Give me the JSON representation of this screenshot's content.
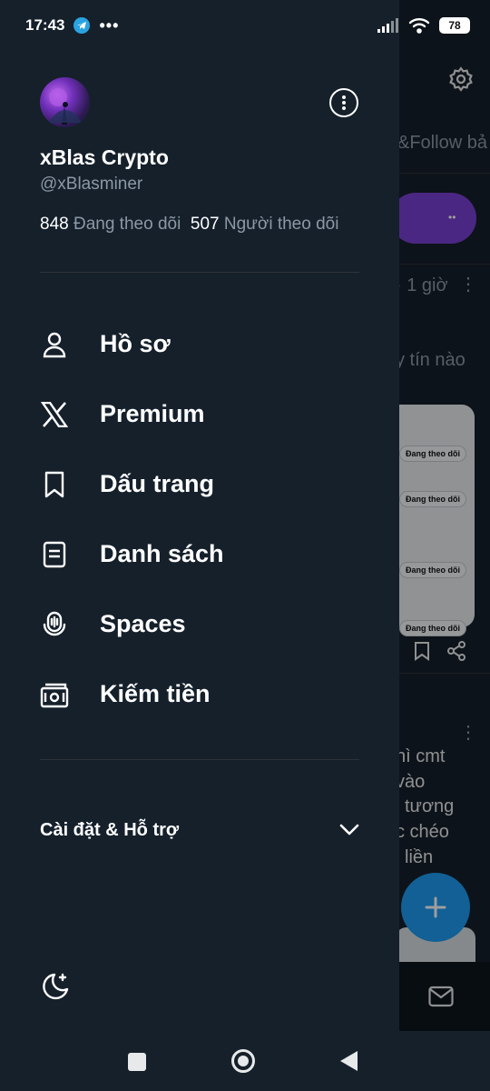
{
  "status_bar": {
    "time": "17:43",
    "more": "•••",
    "battery": "78"
  },
  "background_feed": {
    "tab_partial": "y&Follow bả",
    "time_partial": "· 1 giờ",
    "text_partial": "y tín nào",
    "pills": [
      "Đang theo dõi",
      "Đang theo dõi",
      "Đang theo dõi",
      "Đang theo dõi"
    ],
    "lines": [
      "nì cmt",
      "vào",
      "i tương",
      "c chéo",
      "i liền"
    ]
  },
  "profile": {
    "name": "xBlas Crypto",
    "handle": "@xBlasminer",
    "following_count": "848",
    "following_label": "Đang theo dõi",
    "followers_count": "507",
    "followers_label": "Người theo dõi"
  },
  "menu": [
    {
      "label": "Hồ sơ",
      "icon": "person-icon"
    },
    {
      "label": "Premium",
      "icon": "x-logo-icon"
    },
    {
      "label": "Dấu trang",
      "icon": "bookmark-icon"
    },
    {
      "label": "Danh sách",
      "icon": "list-icon"
    },
    {
      "label": "Spaces",
      "icon": "spaces-mic-icon"
    },
    {
      "label": "Kiếm tiền",
      "icon": "money-icon"
    }
  ],
  "settings": {
    "label": "Cài đặt & Hỗ trợ"
  },
  "colors": {
    "background": "#15202b",
    "accent": "#1d9bf0",
    "muted": "#8b98a5",
    "purple": "#7a40d6"
  }
}
